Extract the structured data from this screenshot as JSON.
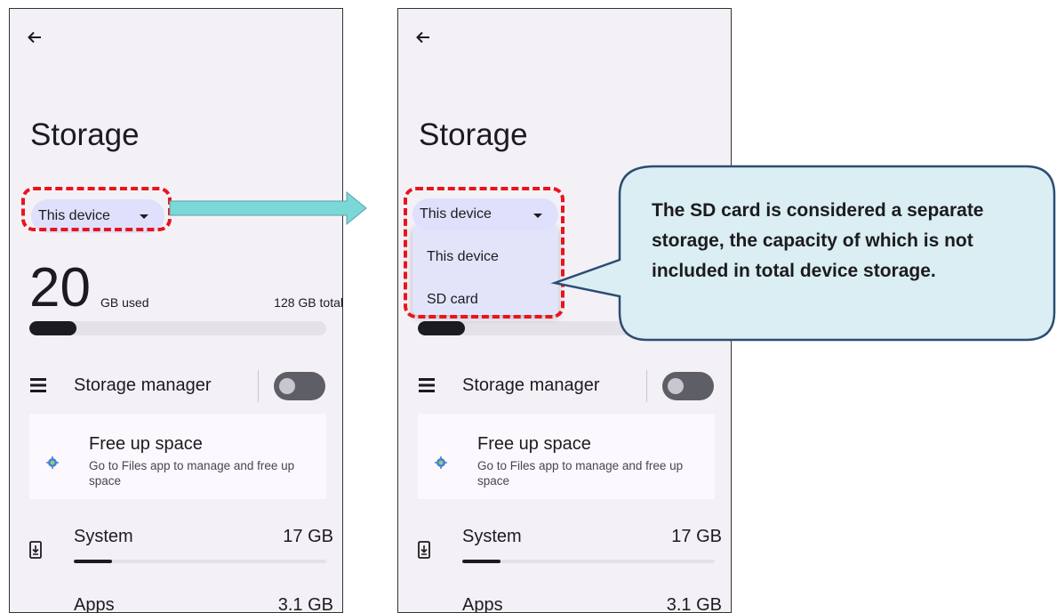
{
  "screens": [
    {
      "title": "Storage",
      "storage_selector": "This device",
      "used_value": "20",
      "used_unit": "GB used",
      "total_label": "128 GB total",
      "used_fraction": 0.16,
      "storage_manager_label": "Storage manager",
      "storage_manager_enabled": false,
      "free_up_title": "Free up space",
      "free_up_description": "Go to Files app to manage and free up space",
      "categories": [
        {
          "name": "System",
          "size": "17 GB",
          "fraction": 0.15,
          "icon": "system-update-icon"
        },
        {
          "name": "Apps",
          "size": "3.1 GB",
          "icon": "more-horiz-icon"
        }
      ]
    },
    {
      "title": "Storage",
      "storage_selector": "This device",
      "dropdown_options": [
        "This device",
        "SD card"
      ],
      "storage_manager_label": "Storage manager",
      "storage_manager_enabled": false,
      "free_up_title": "Free up space",
      "free_up_description": "Go to Files app to manage and free up space",
      "categories": [
        {
          "name": "System",
          "size": "17 GB",
          "fraction": 0.15,
          "icon": "system-update-icon"
        },
        {
          "name": "Apps",
          "size": "3.1 GB",
          "icon": "more-horiz-icon"
        }
      ]
    }
  ],
  "callout": {
    "text": "The SD card is considered a separate storage, the capacity of which is not included in total device storage."
  },
  "colors": {
    "highlight_dash": "#e8141d",
    "arrow": "#7ad8d6",
    "callout_fill": "#daeef3",
    "callout_border": "#2b4d73",
    "chip": "#dfe0fb",
    "screen_bg": "#f4f1f6"
  }
}
